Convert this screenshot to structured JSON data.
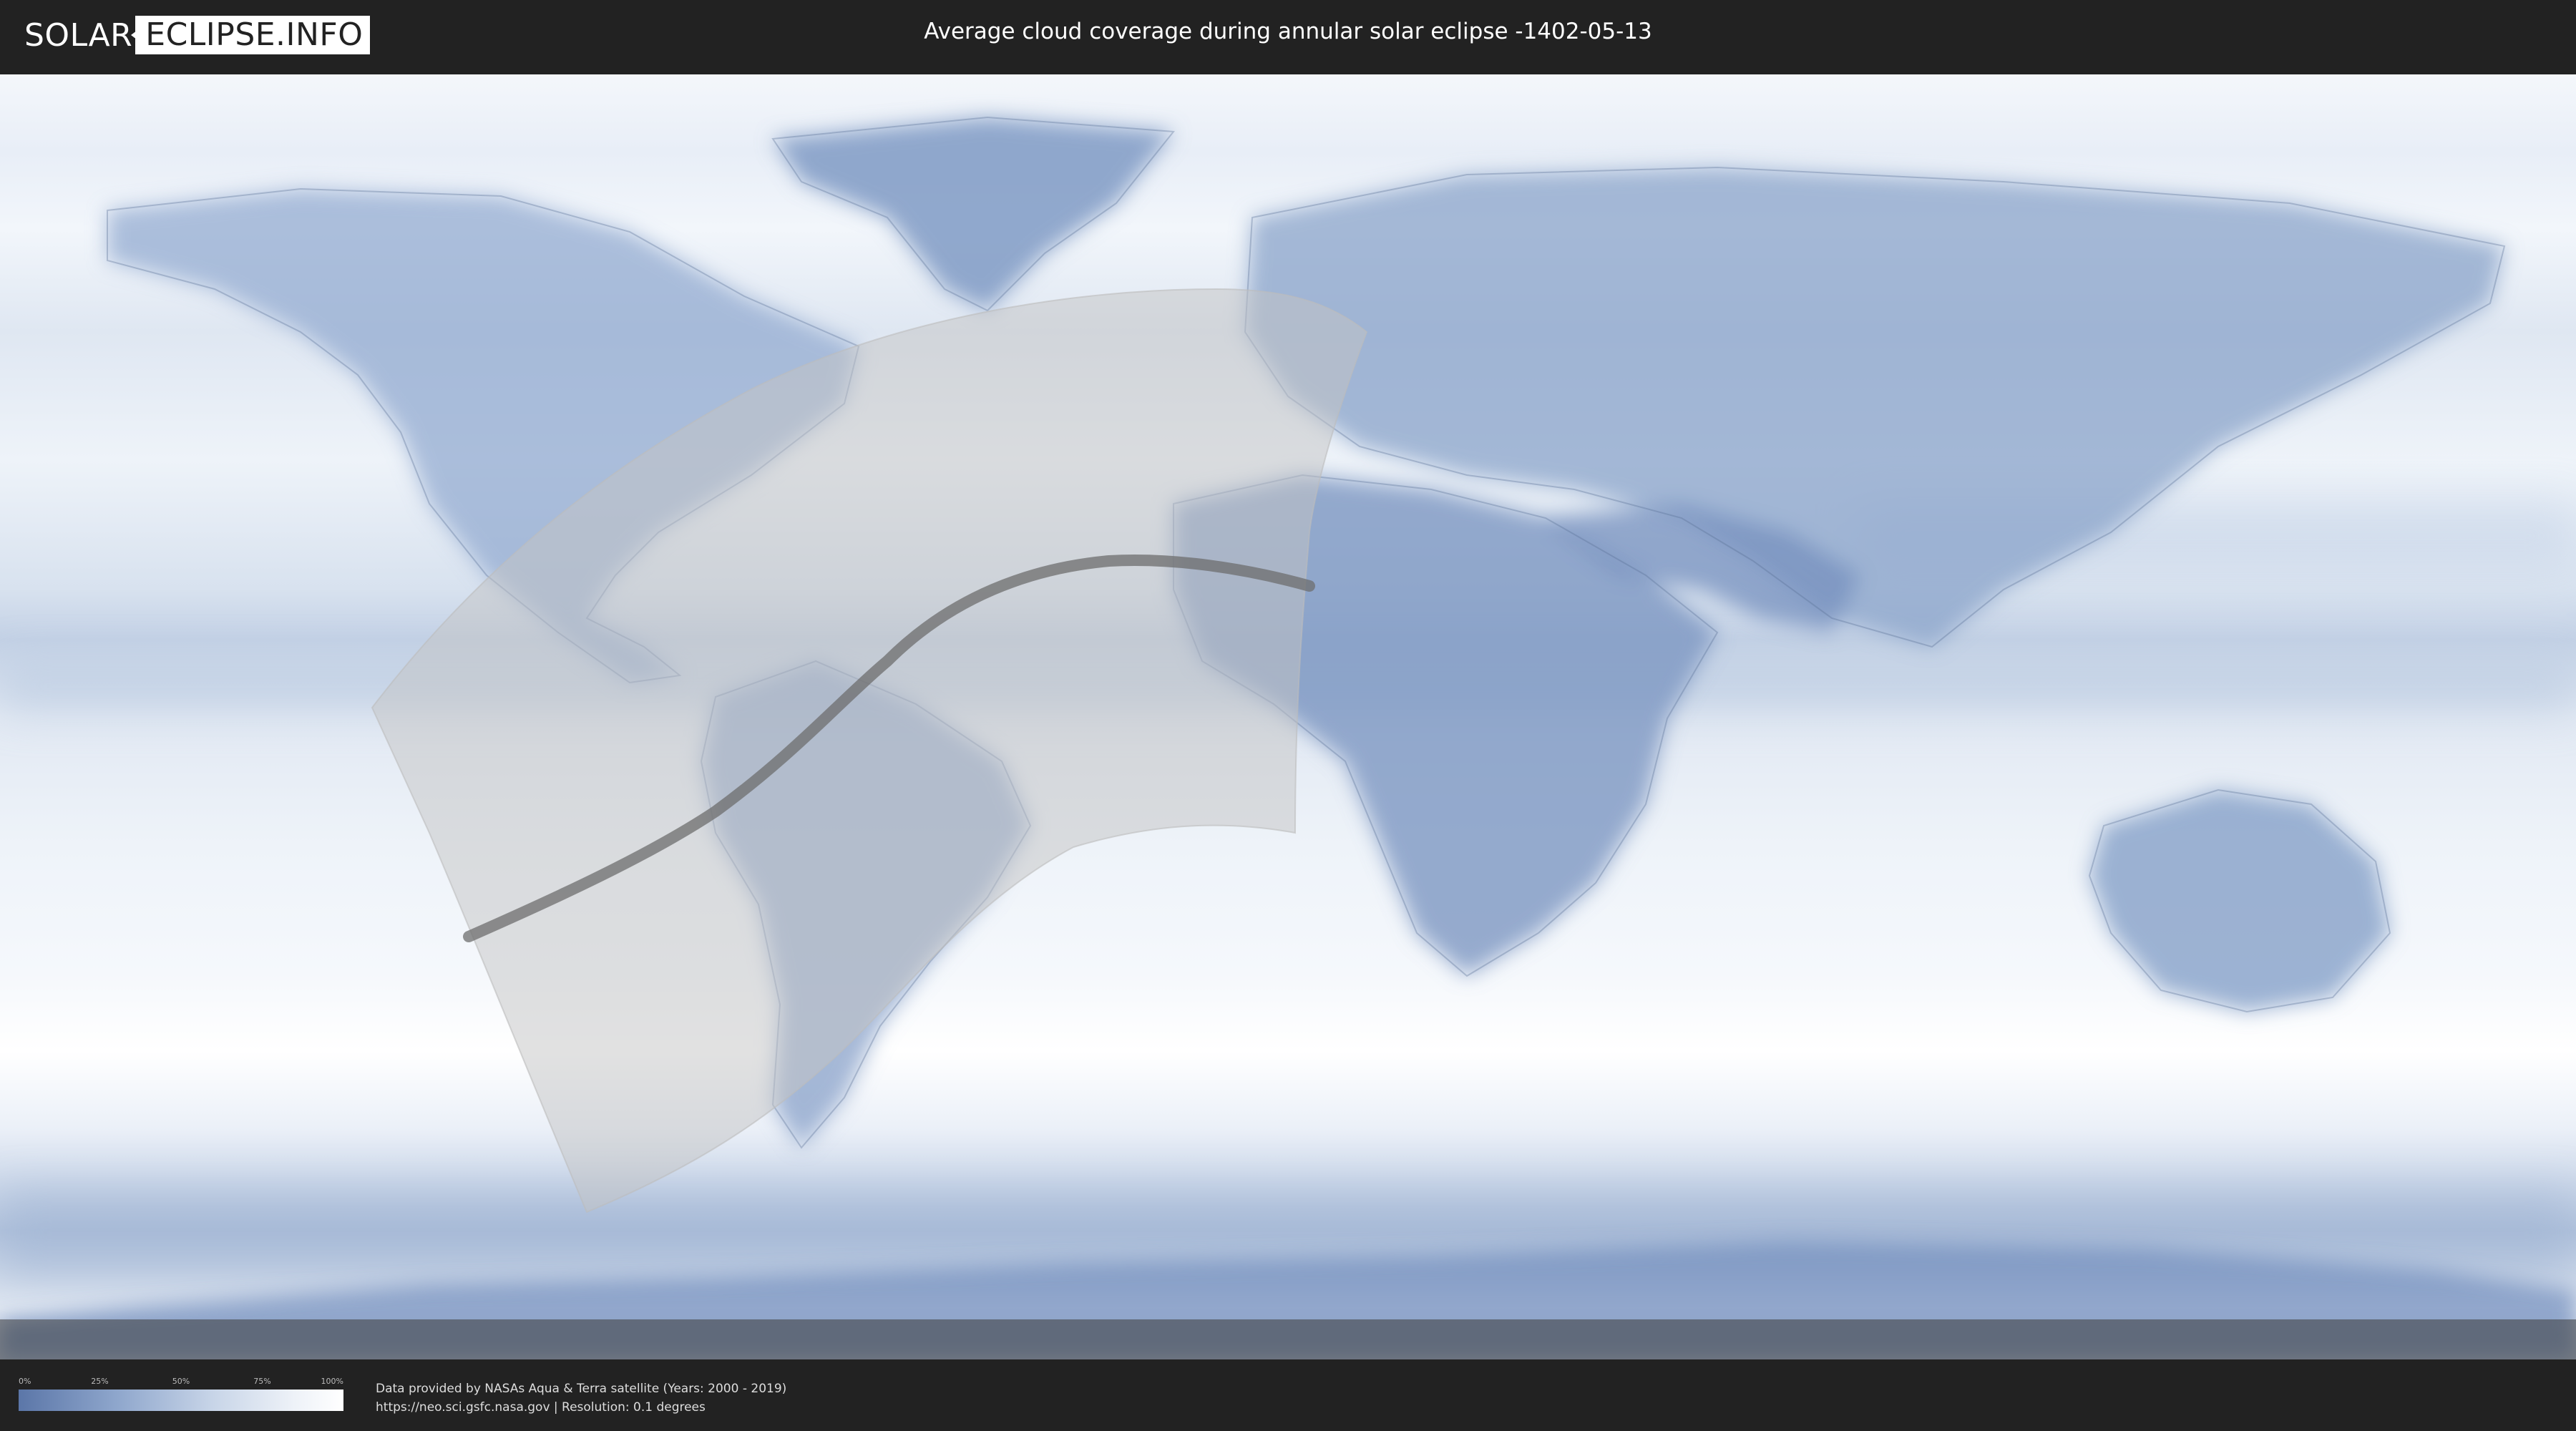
{
  "header": {
    "logo_left": "SOLAR",
    "logo_right": "ECLIPSE.INFO",
    "title": "Average cloud coverage during annular solar eclipse -1402-05-13"
  },
  "legend": {
    "ticks": [
      "0%",
      "25%",
      "50%",
      "75%",
      "100%"
    ],
    "tick_values": [
      0,
      25,
      50,
      75,
      100
    ],
    "color_low": "#5b76a8",
    "color_high": "#ffffff"
  },
  "footer": {
    "credit_line1": "Data provided by NASAs Aqua & Terra satellite (Years: 2000 - 2019)",
    "credit_line2": "https://neo.sci.gsfc.nasa.gov | Resolution: 0.1 degrees"
  },
  "map": {
    "ocean_color": "#eef3f9",
    "cloud_color": "#7f9ac4",
    "shadow_color": "#c9c9c9",
    "path_color": "#6e6e6e"
  }
}
